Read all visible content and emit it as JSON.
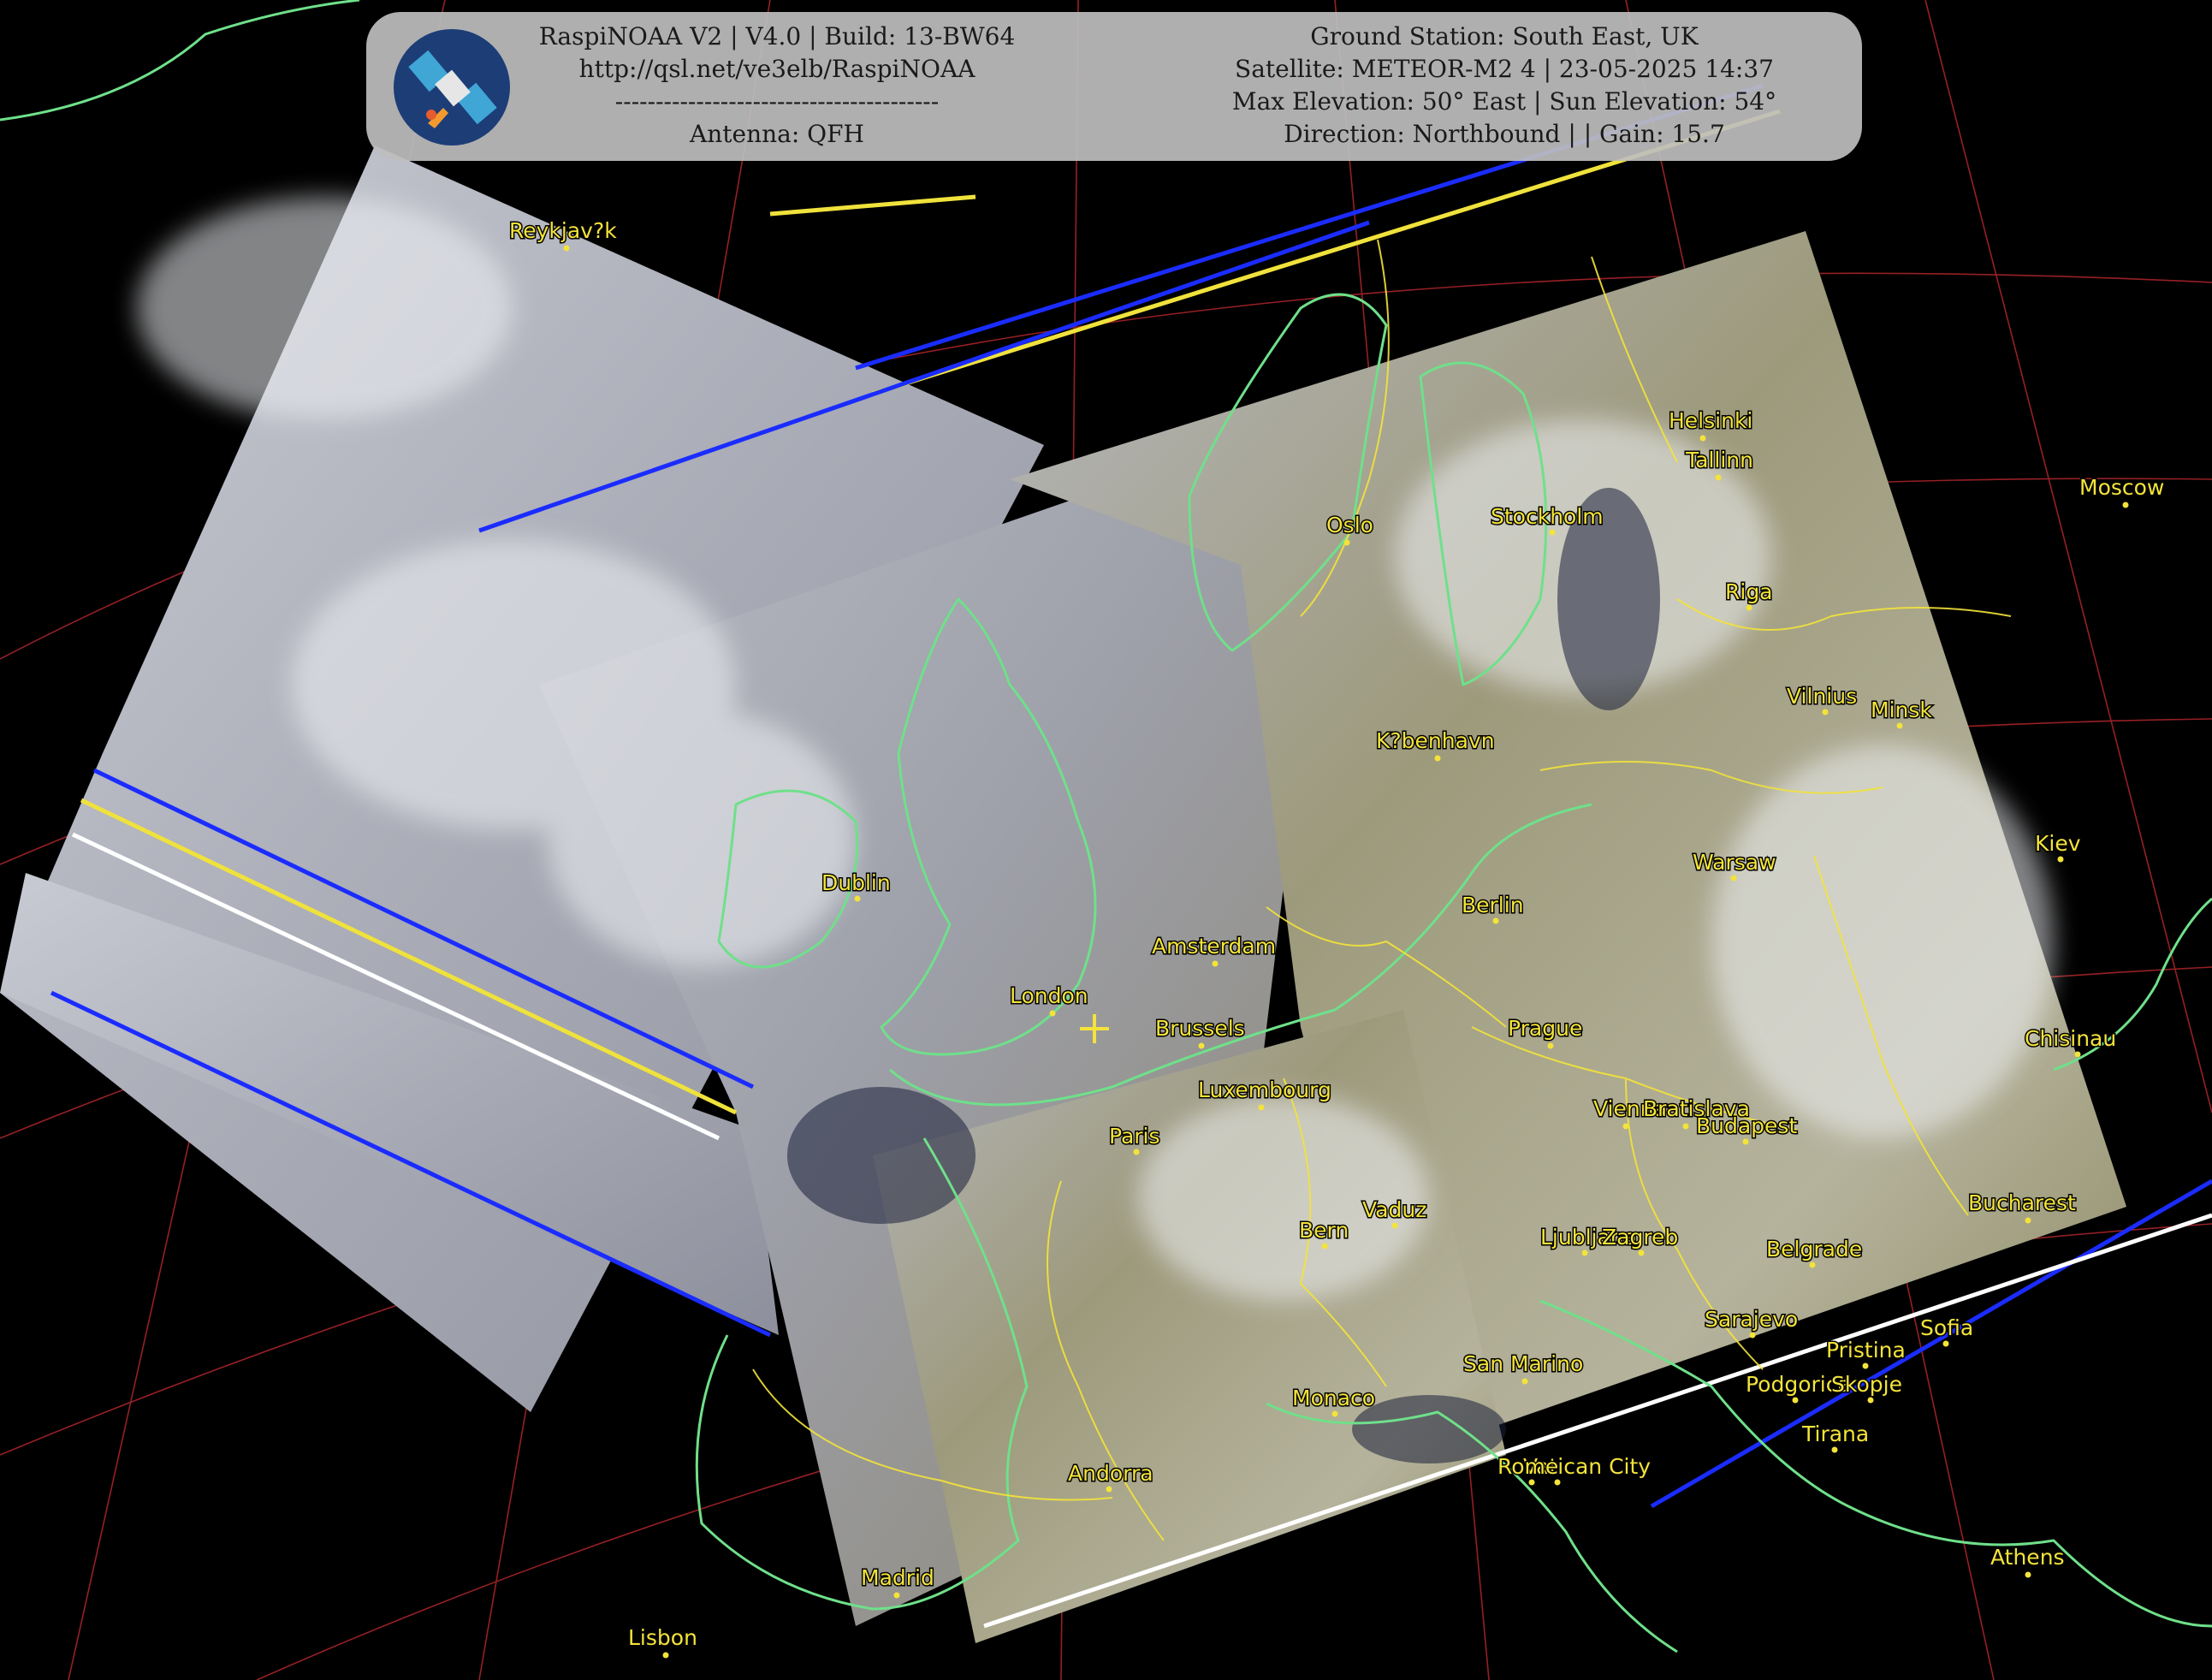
{
  "banner": {
    "software_line": "RaspiNOAA V2 | V4.0 | Build: 13-BW64",
    "url_line": "http://qsl.net/ve3elb/RaspiNOAA",
    "separator_line": "----------------------------------------",
    "antenna_line": "Antenna: QFH",
    "station_line": "Ground Station: South East, UK",
    "satellite_line": "Satellite: METEOR-M2 4 | 23-05-2025 14:37",
    "elevation_line": "Max Elevation: 50° East | Sun Elevation: 54°",
    "direction_line": "Direction: Northbound | | Gain: 15.7",
    "logo_icon": "satellite-icon"
  },
  "colors": {
    "city": "#f3e33a",
    "coastline": "#6fe08a",
    "border": "#f3e33a",
    "graticule": "#b0262c"
  },
  "ground_station_marker": "crosshair-icon",
  "cities": [
    {
      "name": "Reykjav?k"
    },
    {
      "name": "Helsinki"
    },
    {
      "name": "Tallinn"
    },
    {
      "name": "Moscow"
    },
    {
      "name": "Oslo"
    },
    {
      "name": "Stockholm"
    },
    {
      "name": "Riga"
    },
    {
      "name": "Vilnius"
    },
    {
      "name": "Minsk"
    },
    {
      "name": "K?benhavn"
    },
    {
      "name": "Dublin"
    },
    {
      "name": "Warsaw"
    },
    {
      "name": "Kiev"
    },
    {
      "name": "Berlin"
    },
    {
      "name": "Amsterdam"
    },
    {
      "name": "London"
    },
    {
      "name": "Brussels"
    },
    {
      "name": "Prague"
    },
    {
      "name": "Chisinau"
    },
    {
      "name": "Luxembourg"
    },
    {
      "name": "Vienna"
    },
    {
      "name": "Bratislava"
    },
    {
      "name": "Budapest"
    },
    {
      "name": "Paris"
    },
    {
      "name": "Vaduz"
    },
    {
      "name": "Bern"
    },
    {
      "name": "Ljubljana"
    },
    {
      "name": "Zagreb"
    },
    {
      "name": "Belgrade"
    },
    {
      "name": "Bucharest"
    },
    {
      "name": "Sarajevo"
    },
    {
      "name": "Sofia"
    },
    {
      "name": "Pristina"
    },
    {
      "name": "Podgorica"
    },
    {
      "name": "Skopje"
    },
    {
      "name": "San Marino"
    },
    {
      "name": "Monaco"
    },
    {
      "name": "Tirana"
    },
    {
      "name": "Vatican City"
    },
    {
      "name": "Rome"
    },
    {
      "name": "Andorra"
    },
    {
      "name": "Madrid"
    },
    {
      "name": "Athens"
    },
    {
      "name": "Lisbon"
    }
  ]
}
